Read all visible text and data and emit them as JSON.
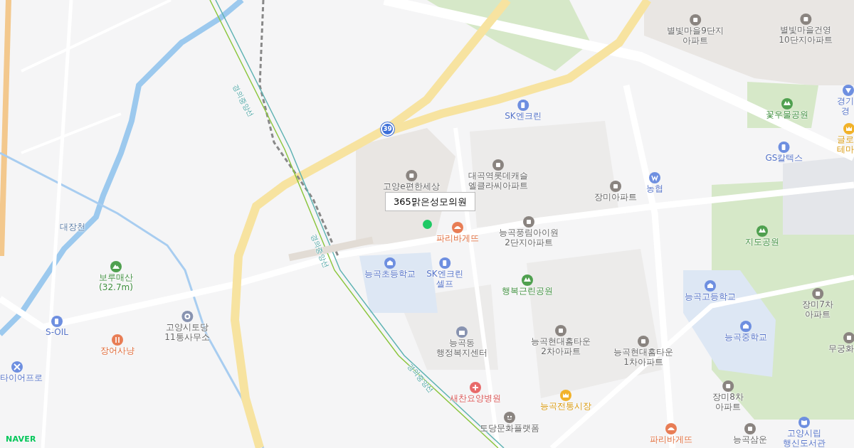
{
  "map": {
    "logo": "NAVER",
    "route_badge": "39",
    "stream_label": "대장천",
    "rail_labels": [
      "경의중앙선",
      "경의중앙선",
      "경의중앙선"
    ],
    "pin": {
      "label": "365맑은성모의원",
      "color": "#1ec964"
    },
    "places": [
      {
        "kind": "apartment",
        "lines": [
          "별빛마을9단지",
          "아파트"
        ]
      },
      {
        "kind": "apartment",
        "lines": [
          "별빛마을건영",
          "10단지아파트"
        ]
      },
      {
        "kind": "gas",
        "lines": [
          "SK엔크린"
        ]
      },
      {
        "kind": "park",
        "lines": [
          "꽃우물공원"
        ]
      },
      {
        "kind": "police",
        "lines": [
          "경기",
          "경"
        ]
      },
      {
        "kind": "gas",
        "lines": [
          "GS칼텍스"
        ]
      },
      {
        "kind": "market",
        "lines": [
          "글로",
          "테마"
        ]
      },
      {
        "kind": "apartment",
        "lines": [
          "고양e편한세상"
        ]
      },
      {
        "kind": "apartment",
        "lines": [
          "대곡역롯데캐슬",
          "엘클라씨아파트"
        ]
      },
      {
        "kind": "apartment",
        "lines": [
          "장미아파트"
        ]
      },
      {
        "kind": "bank",
        "lines": [
          "농협"
        ]
      },
      {
        "kind": "bakery",
        "lines": [
          "파리바게뜨"
        ]
      },
      {
        "kind": "apartment",
        "lines": [
          "능곡풍림아이원",
          "2단지아파트"
        ]
      },
      {
        "kind": "park",
        "lines": [
          "지도공원"
        ]
      },
      {
        "kind": "mountain",
        "lines": [
          "보루매산",
          "(32.7m)"
        ]
      },
      {
        "kind": "school",
        "lines": [
          "능곡초등학교"
        ]
      },
      {
        "kind": "gas",
        "lines": [
          "SK엔크린",
          "셀프"
        ]
      },
      {
        "kind": "park",
        "lines": [
          "행복근린공원"
        ]
      },
      {
        "kind": "school",
        "lines": [
          "능곡고등학교"
        ]
      },
      {
        "kind": "apartment",
        "lines": [
          "장미7차",
          "아파트"
        ]
      },
      {
        "kind": "gas",
        "lines": [
          "S-OIL"
        ]
      },
      {
        "kind": "restaurant",
        "lines": [
          "장어사냥"
        ]
      },
      {
        "kind": "office",
        "lines": [
          "고양시토당",
          "11통사무소"
        ]
      },
      {
        "kind": "government",
        "lines": [
          "능곡동",
          "행정복지센터"
        ]
      },
      {
        "kind": "apartment",
        "lines": [
          "능곡현대홈타운",
          "2차아파트"
        ]
      },
      {
        "kind": "apartment",
        "lines": [
          "능곡현대홈타운",
          "1차아파트"
        ]
      },
      {
        "kind": "school",
        "lines": [
          "능곡중학교"
        ]
      },
      {
        "kind": "apartment",
        "lines": [
          "무궁화"
        ]
      },
      {
        "kind": "tire",
        "lines": [
          "타이어프로"
        ]
      },
      {
        "kind": "hospital",
        "lines": [
          "새찬요양병원"
        ]
      },
      {
        "kind": "market",
        "lines": [
          "능곡전통시장"
        ]
      },
      {
        "kind": "apartment",
        "lines": [
          "장미8차",
          "아파트"
        ]
      },
      {
        "kind": "culture",
        "lines": [
          "토당문화플랫폼"
        ]
      },
      {
        "kind": "bakery",
        "lines": [
          "파리바게뜨"
        ]
      },
      {
        "kind": "apartment",
        "lines": [
          "능곡삼운"
        ]
      },
      {
        "kind": "library",
        "lines": [
          "고양시립",
          "행신도서관"
        ]
      }
    ]
  }
}
